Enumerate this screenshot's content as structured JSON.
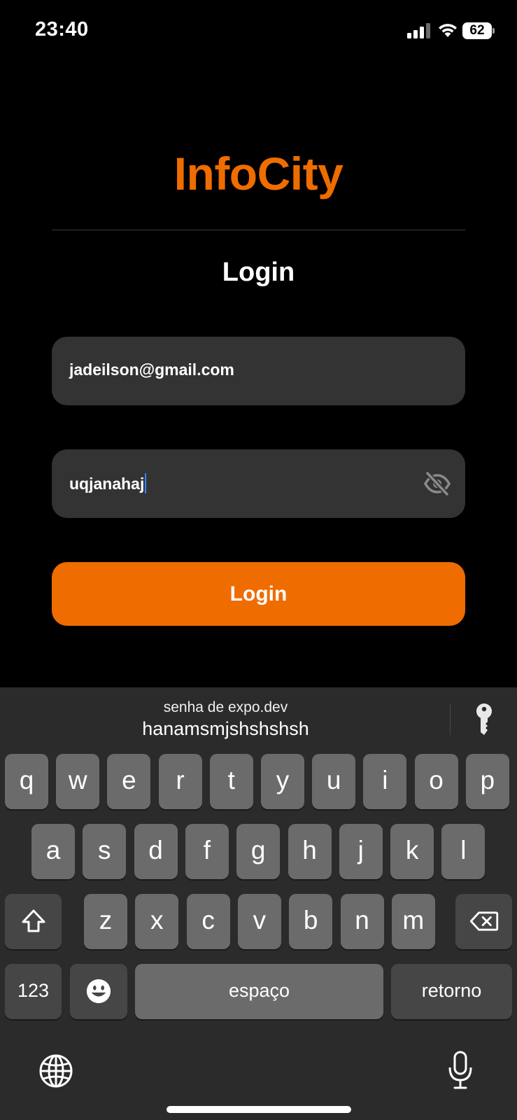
{
  "status_bar": {
    "time": "23:40",
    "battery": "62"
  },
  "app": {
    "brand": "InfoCity",
    "title": "Login",
    "email_value": "jadeilson@gmail.com",
    "password_value": "uqjanahaj",
    "password_visibility_icon": "eye-off-icon",
    "login_button": "Login",
    "colors": {
      "accent": "#ef6c00",
      "field_bg": "#333333",
      "background": "#000000"
    }
  },
  "keyboard": {
    "suggestion_hint": "senha de expo.dev",
    "suggestion_value": "hanamsmjshshshsh",
    "row1": [
      "q",
      "w",
      "e",
      "r",
      "t",
      "y",
      "u",
      "i",
      "o",
      "p"
    ],
    "row2": [
      "a",
      "s",
      "d",
      "f",
      "g",
      "h",
      "j",
      "k",
      "l"
    ],
    "row3": [
      "z",
      "x",
      "c",
      "v",
      "b",
      "n",
      "m"
    ],
    "numbers_key": "123",
    "space_key": "espaço",
    "return_key": "retorno"
  }
}
